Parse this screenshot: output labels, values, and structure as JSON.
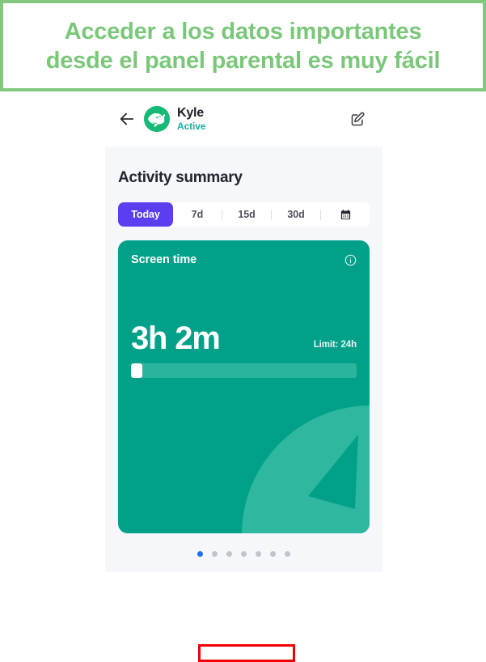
{
  "banner": {
    "line1": "Acceder a los datos importantes",
    "line2": "desde el panel parental es muy fácil",
    "text_color": "#7ac77a",
    "border_color": "#82c97f"
  },
  "app": {
    "header": {
      "back_icon": "arrow-left-icon",
      "avatar_icon": "whale-avatar",
      "profile_name": "Kyle",
      "profile_status": "Active",
      "edit_icon": "edit-square-icon"
    },
    "section_title": "Activity summary",
    "range_tabs": {
      "items": [
        {
          "label": "Today",
          "active": true
        },
        {
          "label": "7d",
          "active": false
        },
        {
          "label": "15d",
          "active": false
        },
        {
          "label": "30d",
          "active": false
        }
      ],
      "calendar_icon": "calendar-icon",
      "active_color": "#5b3ef0"
    },
    "screen_time_card": {
      "title": "Screen time",
      "info_icon": "info-circle-icon",
      "value": "3h 2m",
      "limit_label": "Limit: 24h",
      "progress_percent": 5,
      "card_color": "#00a188",
      "deco_icon": "clock-icon"
    },
    "pagination": {
      "total": 7,
      "active_index": 0,
      "active_color": "#1e6ff2",
      "inactive_color": "#c2c4cc"
    }
  },
  "annotation": {
    "highlight_color": "#f10000",
    "target": "pagination-dots"
  }
}
